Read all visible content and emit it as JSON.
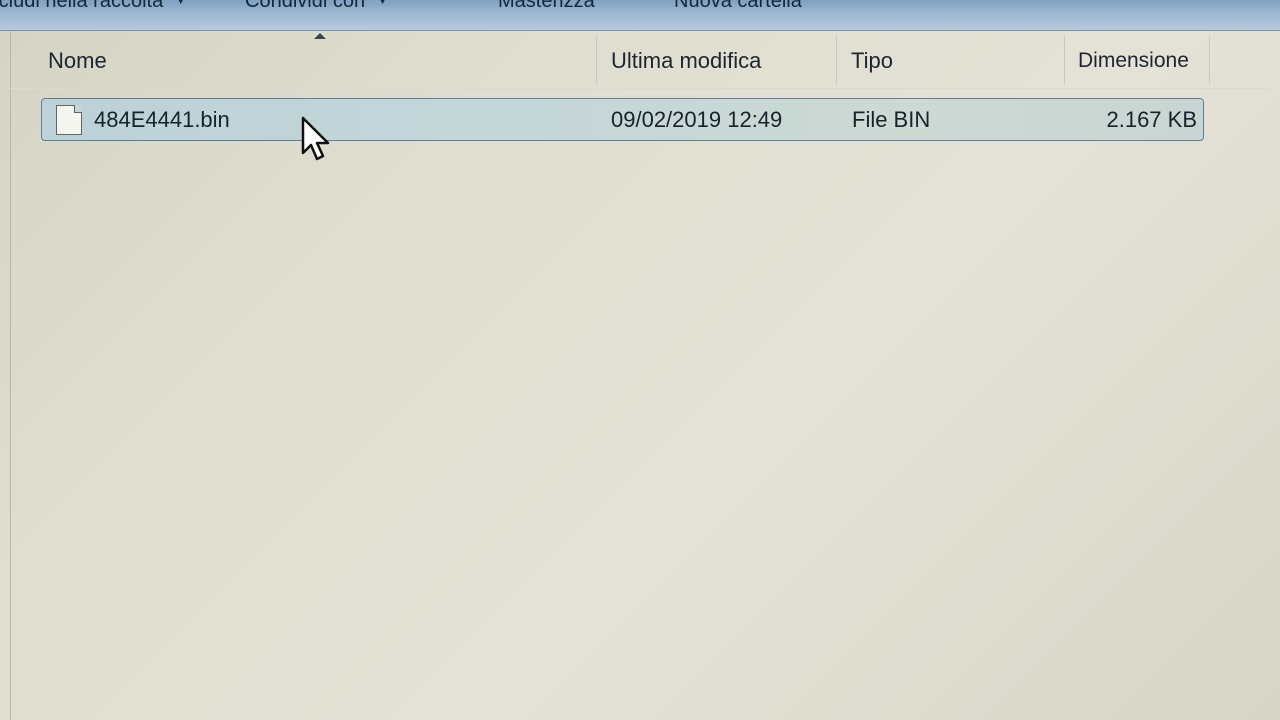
{
  "toolbar": {
    "include_label": "Includi nella raccolta",
    "share_label": "Condividi con",
    "burn_label": "Masterizza",
    "new_folder_label": "Nuova cartella"
  },
  "columns": {
    "name": "Nome",
    "modified": "Ultima modifica",
    "type": "Tipo",
    "size": "Dimensione"
  },
  "files": [
    {
      "name": "484E4441.bin",
      "modified": "09/02/2019 12:49",
      "type": "File BIN",
      "size": "2.167 KB",
      "icon": "file-icon",
      "selected": true
    }
  ]
}
